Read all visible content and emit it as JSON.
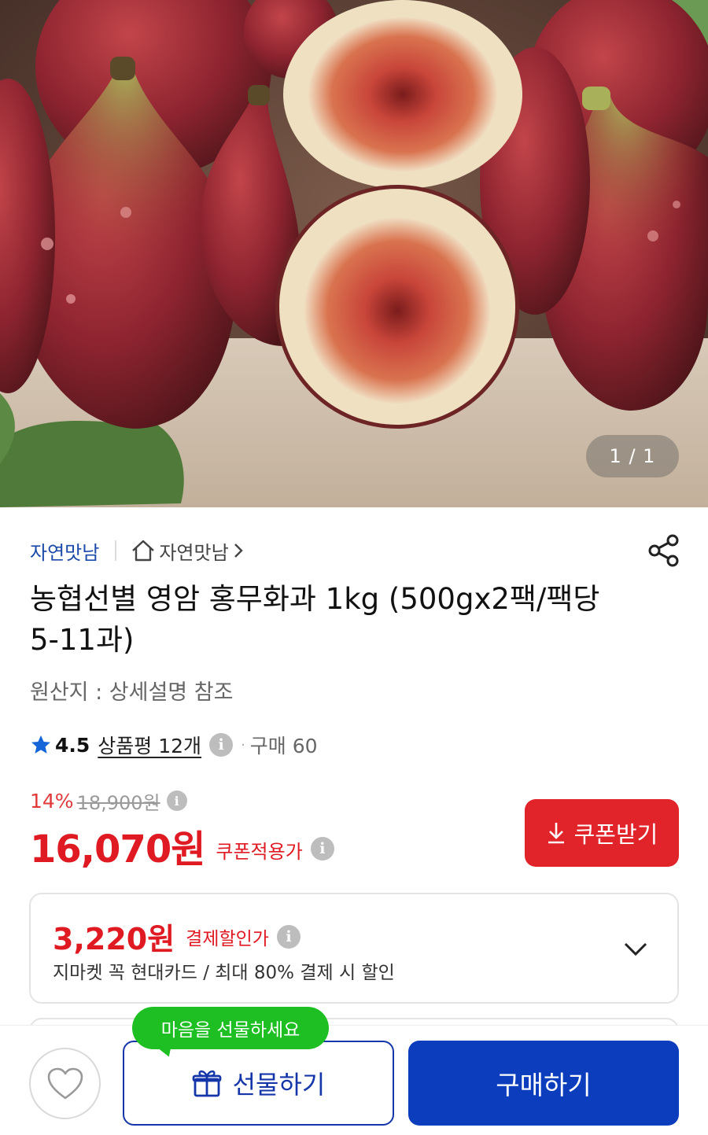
{
  "colors": {
    "brand_blue": "#1b4aa8",
    "price_red": "#e01a22",
    "coupon_red": "#e1232a",
    "buy_blue": "#0b3dbd",
    "tooltip_green": "#1dbf22"
  },
  "hero": {
    "image_icon": "figs-product-photo",
    "pager": "1 / 1"
  },
  "store": {
    "brand": "자연맛남",
    "link_label": "자연맛남",
    "home_icon": "home-icon",
    "share_icon": "share-icon"
  },
  "product": {
    "title": "농협선별 영암 홍무화과 1kg (500gx2팩/팩당5-11과)",
    "origin": "원산지 : 상세설명 참조"
  },
  "rating": {
    "score": "4.5",
    "reviews": "상품평 12개",
    "separator": "·",
    "purchases": "구매 60"
  },
  "price": {
    "discount_rate": "14%",
    "original": "18,900원",
    "final": "16,070원",
    "coupon_label": "쿠폰적용가",
    "coupon_button": "쿠폰받기"
  },
  "payment": {
    "price": "3,220원",
    "label": "결제할인가",
    "description": "지마켓 꼭 현대카드 / 최대 80% 결제 시 할인"
  },
  "bottom": {
    "tooltip": "마음을 선물하세요",
    "gift_button": "선물하기",
    "buy_button": "구매하기"
  }
}
